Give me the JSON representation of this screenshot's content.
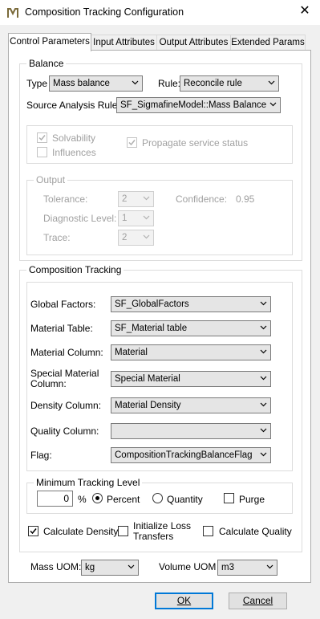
{
  "window": {
    "title": "Composition Tracking Configuration",
    "close_glyph": "✕",
    "app_icon": "app-logo-icon"
  },
  "tabs": [
    "Control Parameters",
    "Input Attributes",
    "Output Attributes",
    "Extended Params"
  ],
  "balance": {
    "legend": "Balance",
    "type_label": "Type",
    "type_value": "Mass balance",
    "rule_label": "Rule:",
    "rule_value": "Reconcile rule",
    "source_label": "Source Analysis Rule:",
    "source_value": "SF_SigmafineModel::Mass Balance",
    "solvability_label": "Solvability",
    "influences_label": "Influences",
    "propagate_label": "Propagate service status",
    "output": {
      "legend": "Output",
      "tolerance_label": "Tolerance:",
      "tolerance_value": "2",
      "confidence_label": "Confidence:",
      "confidence_value": "0.95",
      "diagnostic_label": "Diagnostic Level:",
      "diagnostic_value": "1",
      "trace_label": "Trace:",
      "trace_value": "2"
    }
  },
  "composition": {
    "legend": "Composition Tracking",
    "global_factors_label": "Global Factors:",
    "global_factors_value": "SF_GlobalFactors",
    "material_table_label": "Material Table:",
    "material_table_value": "SF_Material table",
    "material_column_label": "Material Column:",
    "material_column_value": "Material",
    "special_material_label_1": "Special Material",
    "special_material_label_2": "Column:",
    "special_material_value": "Special Material",
    "density_label": "Density Column:",
    "density_value": "Material Density",
    "quality_label": "Quality Column:",
    "quality_value": "",
    "flag_label": "Flag:",
    "flag_value": "CompositionTrackingBalanceFlag",
    "min_tracking": {
      "legend": "Minimum Tracking Level",
      "value": "0",
      "unit": "%",
      "percent_label": "Percent",
      "quantity_label": "Quantity",
      "purge_label": "Purge",
      "selected": "Percent",
      "purge_checked": false
    },
    "calc_density_label": "Calculate Density",
    "calc_density_checked": true,
    "init_loss_label_1": "Initialize Loss",
    "init_loss_label_2": "Transfers",
    "init_loss_checked": false,
    "calc_quality_label": "Calculate Quality",
    "calc_quality_checked": false
  },
  "uom": {
    "mass_label": "Mass UOM:",
    "mass_value": "kg",
    "volume_label": "Volume UOM",
    "volume_value": "m3"
  },
  "buttons": {
    "ok_label": "OK",
    "cancel_label": "Cancel"
  },
  "colors": {
    "accent": "#0078d7",
    "disabled_text": "#a0a0a0"
  }
}
